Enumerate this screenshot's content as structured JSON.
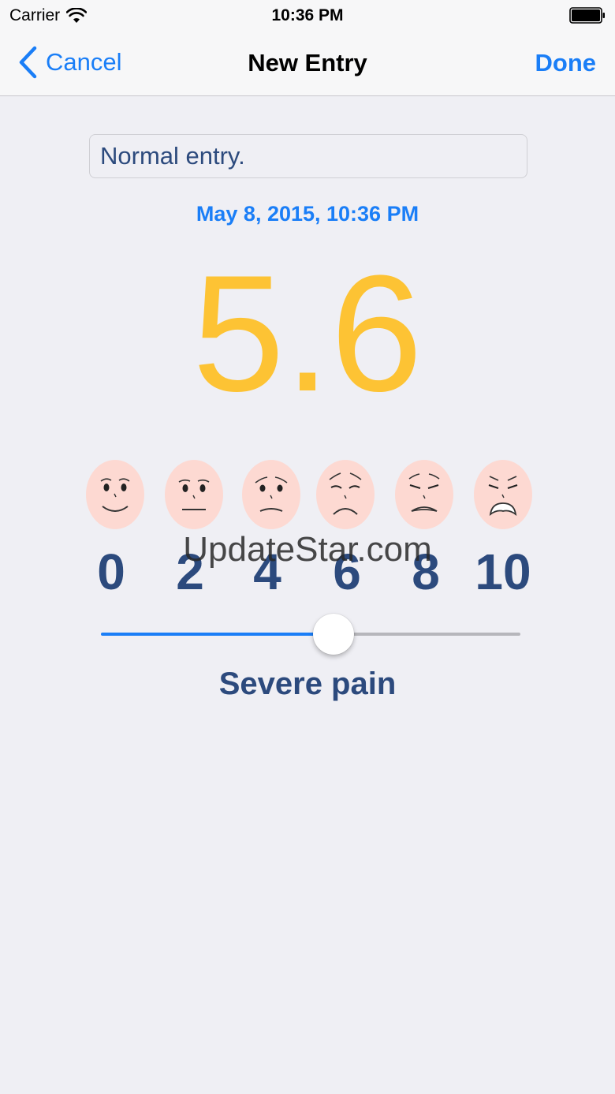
{
  "status_bar": {
    "carrier": "Carrier",
    "time": "10:36 PM"
  },
  "nav": {
    "cancel_label": "Cancel",
    "title": "New Entry",
    "done_label": "Done"
  },
  "entry": {
    "note_value": "Normal entry.",
    "date": "May 8, 2015, 10:36 PM",
    "score": "5.6",
    "pain_label": "Severe pain"
  },
  "scale": {
    "labels": [
      "0",
      "2",
      "4",
      "6",
      "8",
      "10"
    ],
    "faces": [
      "smiling-face-icon",
      "neutral-face-icon",
      "worried-face-icon",
      "sad-face-icon",
      "distressed-face-icon",
      "crying-face-icon"
    ]
  },
  "slider": {
    "min": 0,
    "max": 10,
    "value": 5.6
  },
  "watermark": "UpdateStar.com",
  "colors": {
    "accent": "#1a7ef7",
    "score": "#fdc334",
    "scale_text": "#2c4a7d",
    "face": "#fdd9d2"
  }
}
